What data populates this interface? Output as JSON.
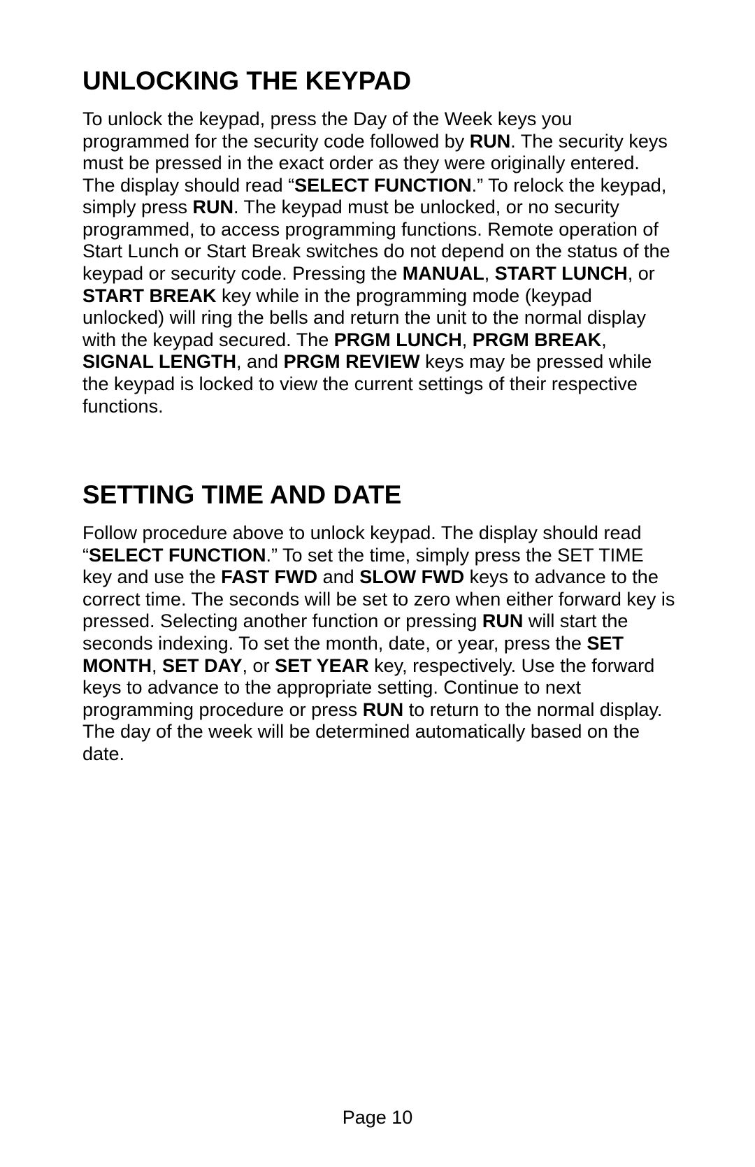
{
  "section1": {
    "heading": "UNLOCKING THE KEYPAD",
    "p1_a": "To unlock the keypad, press the Day of the Week keys you programmed for the security code followed by ",
    "p1_b": "RUN",
    "p1_c": ".  The security keys must be pressed in the exact order as they were originally entered.  The display should read “",
    "p1_d": "SELECT FUNCTION",
    "p1_e": ".”  To relock the keypad, simply press ",
    "p1_f": "RUN",
    "p1_g": ".  The keypad must be unlocked, or no security programmed, to access programming functions.  Remote operation of Start Lunch or Start Break switches do not depend on the status of the keypad or security code.  Pressing the ",
    "p1_h": "MANUAL",
    "p1_i": ", ",
    "p1_j": "START LUNCH",
    "p1_k": ", or ",
    "p1_l": "START BREAK",
    "p1_m": " key while in the programming mode (keypad unlocked) will ring the bells and return the unit to the normal display with the keypad secured.  The ",
    "p1_n": "PRGM LUNCH",
    "p1_o": ", ",
    "p1_p": "PRGM BREAK",
    "p1_q": ", ",
    "p1_r": "SIGNAL LENGTH",
    "p1_s": ", and ",
    "p1_t": "PRGM REVIEW",
    "p1_u": " keys may be pressed while the keypad is locked to view the current settings of their respective functions."
  },
  "section2": {
    "heading": "SETTING TIME AND DATE",
    "p1_a": "Follow procedure above to unlock keypad.  The display should read “",
    "p1_b": "SELECT FUNCTION",
    "p1_c": ".”  To set the time, simply press the SET TIME key and use the ",
    "p1_d": "FAST FWD",
    "p1_e": " and ",
    "p1_f": "SLOW FWD",
    "p1_g": " keys to advance to the correct time. The seconds will be set to zero when either forward key is pressed.  Selecting another function or pressing ",
    "p1_h": "RUN",
    "p1_i": " will start the seconds indexing.  To set the month, date, or year, press the ",
    "p1_j": "SET MONTH",
    "p1_k": ", ",
    "p1_l": "SET DAY",
    "p1_m": ", or ",
    "p1_n": "SET YEAR",
    "p1_o": " key, respectively.  Use the forward keys to advance to the appropriate setting.  Continue to next programming procedure or press ",
    "p1_p": "RUN",
    "p1_q": " to return to the normal display.  The day of the week will be determined automatically based on the date."
  },
  "page_number": "Page 10"
}
